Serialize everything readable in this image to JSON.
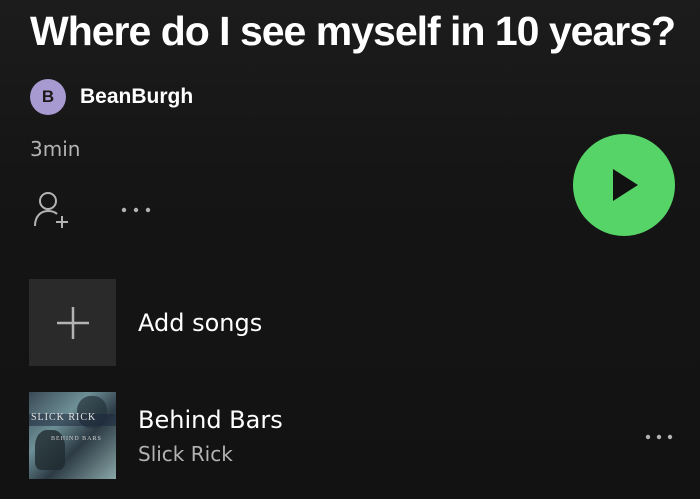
{
  "playlist": {
    "title": "Where do I see myself in 10 years?",
    "owner": {
      "initial": "B",
      "name": "BeanBurgh",
      "avatar_color": "#a79ad1"
    },
    "duration": "3min"
  },
  "actions": {
    "follow_icon": "add-user-icon",
    "more_icon": "more-horizontal-icon",
    "play_icon": "play-icon",
    "play_color": "#57d468"
  },
  "add_songs": {
    "label": "Add songs",
    "icon": "plus-icon"
  },
  "tracks": [
    {
      "title": "Behind Bars",
      "artist": "Slick Rick",
      "cover_text": "SLICK RICK",
      "cover_subtext": "BEHIND BARS"
    }
  ]
}
